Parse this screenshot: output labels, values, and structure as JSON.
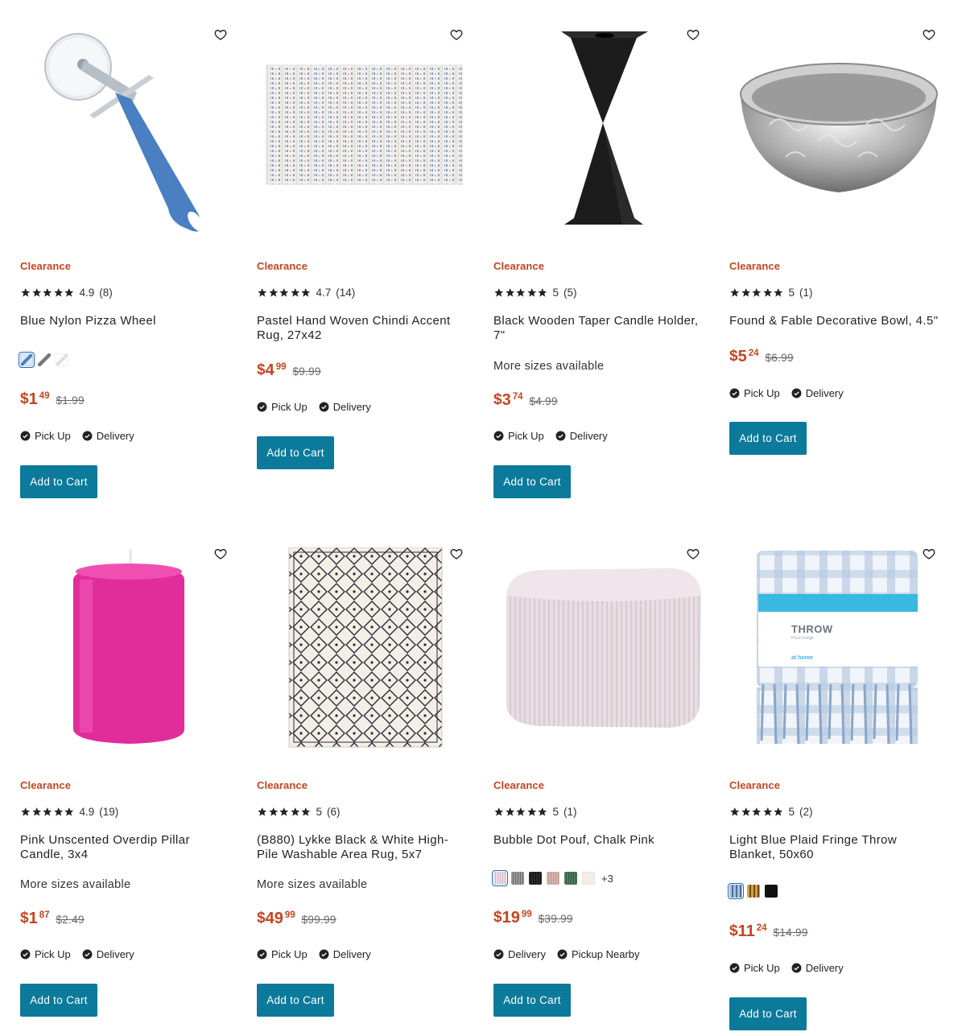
{
  "products": [
    {
      "badge": "Clearance",
      "rating": "4.9",
      "reviews": "(8)",
      "title": "Blue Nylon Pizza Wheel",
      "more": "",
      "price_dollars": "1",
      "price_cents": "49",
      "price_orig": "$1.99",
      "fulfillment": [
        "Pick Up",
        "Delivery"
      ],
      "add_label": "Add to Cart",
      "swatches": [
        "swatch-blue-wheel",
        "swatch-gray-wheel",
        "swatch-white-wheel"
      ],
      "swatch_more": ""
    },
    {
      "badge": "Clearance",
      "rating": "4.7",
      "reviews": "(14)",
      "title": "Pastel Hand Woven Chindi Accent Rug, 27x42",
      "more": "",
      "price_dollars": "4",
      "price_cents": "99",
      "price_orig": "$9.99",
      "fulfillment": [
        "Pick Up",
        "Delivery"
      ],
      "add_label": "Add to Cart",
      "swatches": [],
      "swatch_more": ""
    },
    {
      "badge": "Clearance",
      "rating": "5",
      "reviews": "(5)",
      "title": "Black Wooden Taper Candle Holder, 7\"",
      "more": "More sizes available",
      "price_dollars": "3",
      "price_cents": "74",
      "price_orig": "$4.99",
      "fulfillment": [
        "Pick Up",
        "Delivery"
      ],
      "add_label": "Add to Cart",
      "swatches": [],
      "swatch_more": ""
    },
    {
      "badge": "Clearance",
      "rating": "5",
      "reviews": "(1)",
      "title": "Found & Fable Decorative Bowl, 4.5\"",
      "more": "",
      "price_dollars": "5",
      "price_cents": "24",
      "price_orig": "$6.99",
      "fulfillment": [
        "Pick Up",
        "Delivery"
      ],
      "add_label": "Add to Cart",
      "swatches": [],
      "swatch_more": ""
    },
    {
      "badge": "Clearance",
      "rating": "4.9",
      "reviews": "(19)",
      "title": "Pink Unscented Overdip Pillar Candle, 3x4",
      "more": "More sizes available",
      "price_dollars": "1",
      "price_cents": "87",
      "price_orig": "$2.49",
      "fulfillment": [
        "Pick Up",
        "Delivery"
      ],
      "add_label": "Add to Cart",
      "swatches": [],
      "swatch_more": ""
    },
    {
      "badge": "Clearance",
      "rating": "5",
      "reviews": "(6)",
      "title": "(B880) Lykke Black & White High-Pile Washable Area Rug, 5x7",
      "more": "More sizes available",
      "price_dollars": "49",
      "price_cents": "99",
      "price_orig": "$99.99",
      "fulfillment": [
        "Pick Up",
        "Delivery"
      ],
      "add_label": "Add to Cart",
      "swatches": [],
      "swatch_more": ""
    },
    {
      "badge": "Clearance",
      "rating": "5",
      "reviews": "(1)",
      "title": "Bubble Dot Pouf, Chalk Pink",
      "more": "",
      "price_dollars": "19",
      "price_cents": "99",
      "price_orig": "$39.99",
      "fulfillment": [
        "Delivery",
        "Pickup Nearby"
      ],
      "add_label": "Add to Cart",
      "swatches": [
        "swatch-pink",
        "swatch-gray",
        "swatch-black",
        "swatch-blush",
        "swatch-green",
        "swatch-cream"
      ],
      "swatch_more": "+3"
    },
    {
      "badge": "Clearance",
      "rating": "5",
      "reviews": "(2)",
      "title": "Light Blue Plaid Fringe Throw Blanket, 50x60",
      "more": "",
      "price_dollars": "11",
      "price_cents": "24",
      "price_orig": "$14.99",
      "fulfillment": [
        "Pick Up",
        "Delivery"
      ],
      "add_label": "Add to Cart",
      "swatches": [
        "swatch-blue-plaid",
        "swatch-mustard-plaid",
        "swatch-black-plaid"
      ],
      "swatch_more": ""
    }
  ],
  "throw_label": {
    "brand": "THROW",
    "sub": "Plush Fringe",
    "store": "at home"
  },
  "colors": {
    "accent_button": "#0b7a9b",
    "sale_price": "#c6441f",
    "clearance": "#c6441f"
  }
}
